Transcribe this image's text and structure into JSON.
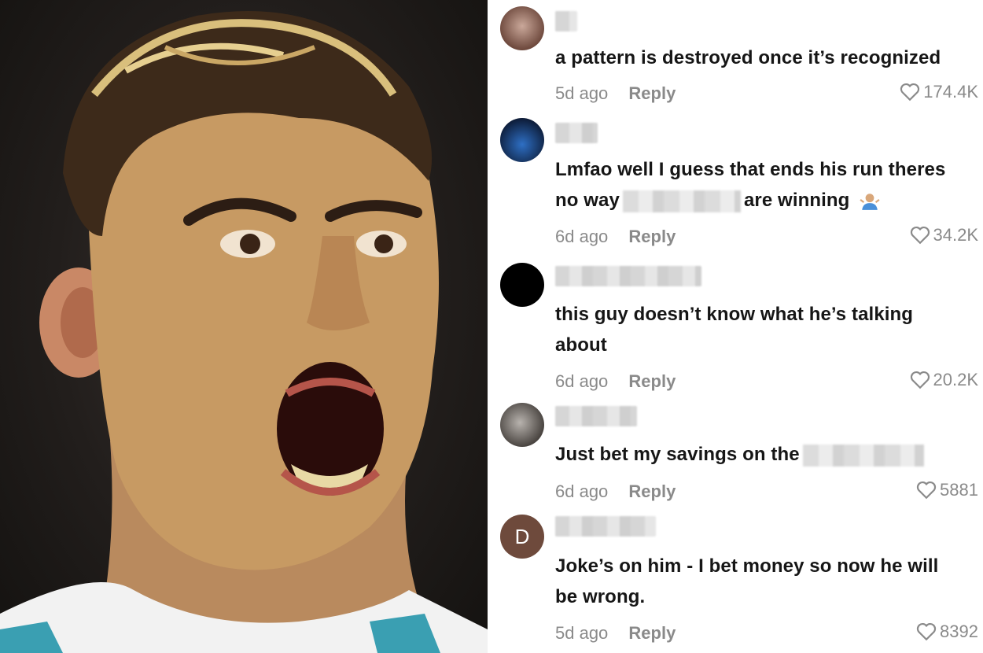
{
  "photo": {
    "subject_icon": "shouting-athlete-photo"
  },
  "comments": [
    {
      "avatar_icon": "cat-avatar-icon",
      "text": "a pattern is destroyed once it’s recognized",
      "time": "5d ago",
      "reply": "Reply",
      "likes": "174.4K"
    },
    {
      "avatar_icon": "stadium-avatar-icon",
      "text_before": "Lmfao well I guess that ends his run theres no way",
      "text_after": "are winning",
      "emoji_icon": "shrug-emoji-icon",
      "time": "6d ago",
      "reply": "Reply",
      "likes": "34.2K"
    },
    {
      "avatar_icon": "black-circle-avatar-icon",
      "text": "this guy doesn’t know what he’s talking about",
      "time": "6d ago",
      "reply": "Reply",
      "likes": "20.2K"
    },
    {
      "avatar_icon": "person-avatar-icon",
      "text": "Just bet my savings on the",
      "time": "6d ago",
      "reply": "Reply",
      "likes": "5881"
    },
    {
      "avatar_letter": "D",
      "text": "Joke’s on him - I bet money so now he will be wrong.",
      "time": "5d ago",
      "reply": "Reply",
      "likes": "8392"
    }
  ],
  "colors": {
    "meta_gray": "#8a8a8a",
    "text": "#161616",
    "avatar_letter_bg": "#6e4a3c"
  }
}
